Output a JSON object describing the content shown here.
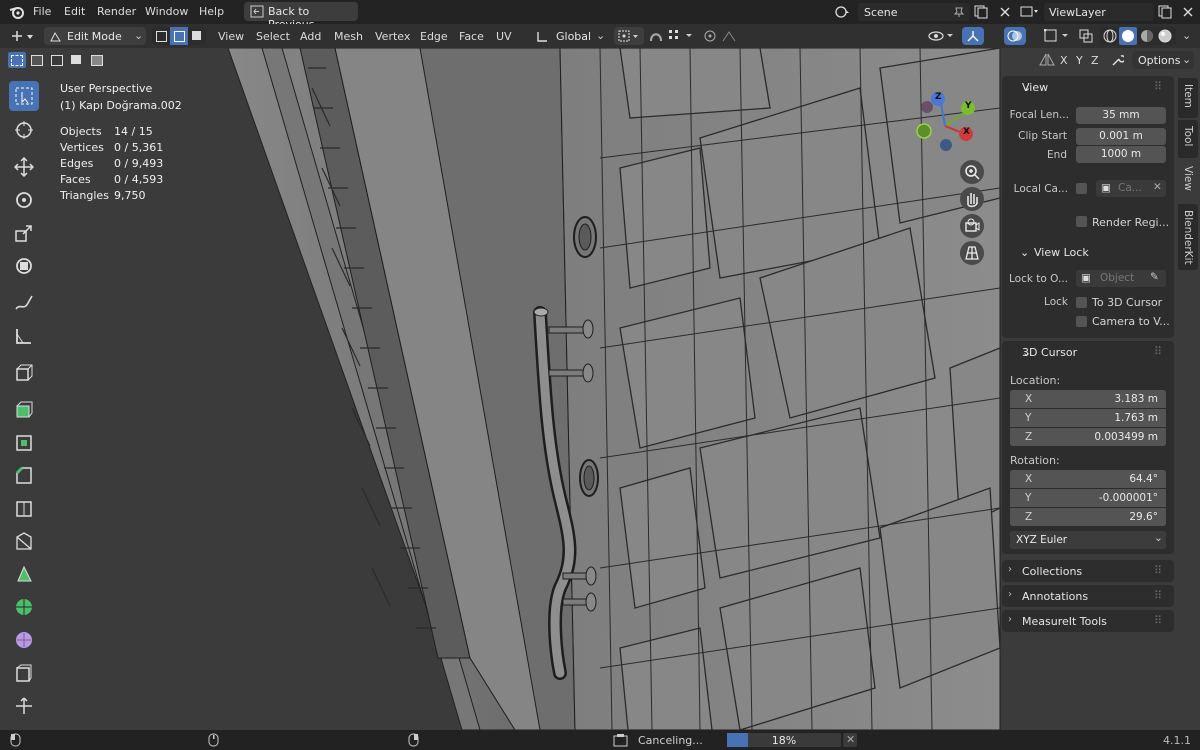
{
  "menu": {
    "items": [
      "File",
      "Edit",
      "Render",
      "Window",
      "Help"
    ],
    "back_to_previous": "Back to Previous",
    "scene": "Scene",
    "view_layer": "ViewLayer"
  },
  "header": {
    "mode": "Edit Mode",
    "menus": [
      "View",
      "Select",
      "Add",
      "Mesh",
      "Vertex",
      "Edge",
      "Face",
      "UV"
    ],
    "transform_orientation": "Global",
    "options": "Options",
    "axes": [
      "X",
      "Y",
      "Z"
    ]
  },
  "overlay": {
    "view_name": "User Perspective",
    "object_name": "(1) Kapı Doğrama.002",
    "stats": [
      {
        "label": "Objects",
        "value": "14 / 15"
      },
      {
        "label": "Vertices",
        "value": "0 / 5,361"
      },
      {
        "label": "Edges",
        "value": "0 / 9,493"
      },
      {
        "label": "Faces",
        "value": "0 / 4,593"
      },
      {
        "label": "Triangles",
        "value": "9,750"
      }
    ]
  },
  "gizmo": {
    "x": "X",
    "y": "Y",
    "z": "Z"
  },
  "npanel": {
    "view": {
      "title": "View",
      "focal_label": "Focal Len...",
      "focal_value": "35 mm",
      "clip_start_label": "Clip Start",
      "clip_start_value": "0.001 m",
      "end_label": "End",
      "end_value": "1000 m",
      "local_camera_label": "Local Ca...",
      "local_camera_value": "Ca...",
      "render_region": "Render Regi...",
      "view_lock_title": "View Lock",
      "lock_to_object_label": "Lock to O...",
      "lock_to_object_placeholder": "Object",
      "lock_label": "Lock",
      "to_3d_cursor": "To 3D Cursor",
      "camera_to_view": "Camera to V..."
    },
    "cursor": {
      "title": "3D Cursor",
      "location_label": "Location:",
      "location": [
        {
          "axis": "X",
          "value": "3.183 m"
        },
        {
          "axis": "Y",
          "value": "1.763 m"
        },
        {
          "axis": "Z",
          "value": "0.003499 m"
        }
      ],
      "rotation_label": "Rotation:",
      "rotation": [
        {
          "axis": "X",
          "value": "64.4°"
        },
        {
          "axis": "Y",
          "value": "-0.000001°"
        },
        {
          "axis": "Z",
          "value": "29.6°"
        }
      ],
      "rotation_mode": "XYZ Euler"
    },
    "collapsed": [
      "Collections",
      "Annotations",
      "MeasureIt Tools"
    ]
  },
  "sidetabs": [
    "Item",
    "Tool",
    "View",
    "BlenderKit"
  ],
  "status": {
    "message": "Canceling...",
    "progress_text": "18%",
    "progress": 0.18,
    "version": "4.1.1"
  }
}
